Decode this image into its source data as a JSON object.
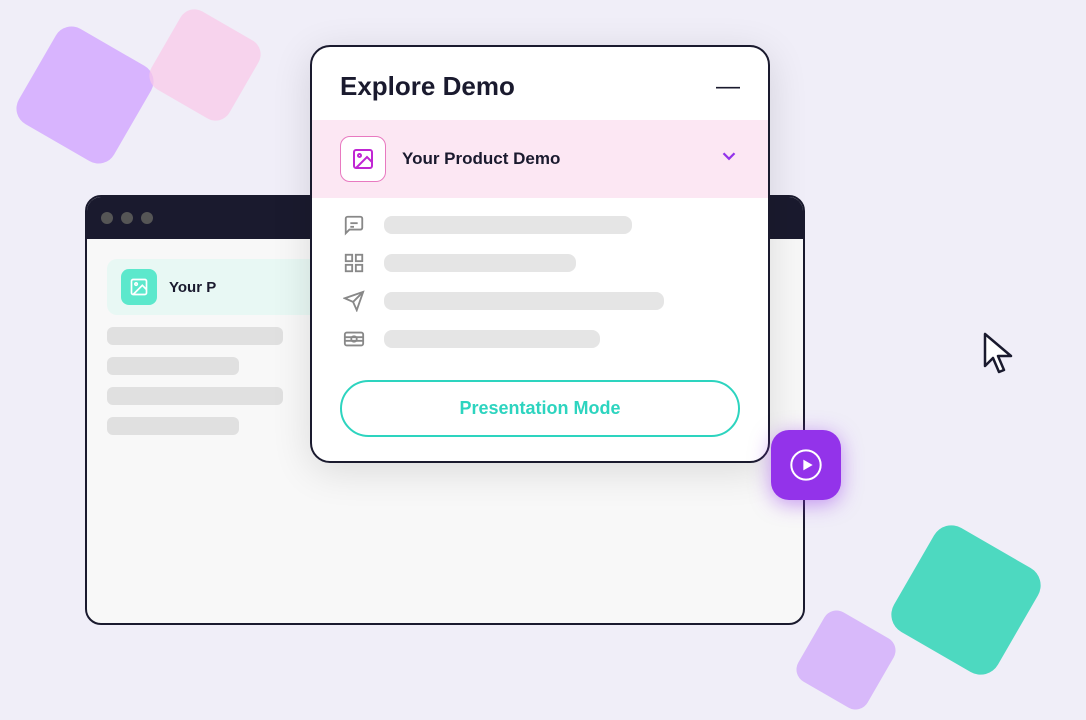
{
  "background": {
    "color": "#f0eef8"
  },
  "modal": {
    "title": "Explore Demo",
    "minimize_label": "—",
    "selected_item": {
      "label": "Your Product Demo",
      "icon_alt": "image-icon"
    },
    "menu_items": [
      {
        "icon": "chat-icon",
        "bar_width": "62%"
      },
      {
        "icon": "layout-icon",
        "bar_width": "48%"
      },
      {
        "icon": "send-icon",
        "bar_width": "70%"
      },
      {
        "icon": "dollar-icon",
        "bar_width": "54%"
      }
    ],
    "presentation_button": {
      "label": "Presentation Mode"
    }
  },
  "bg_browser": {
    "sidebar_item_label": "Your P"
  },
  "play_button": {
    "icon": "play-icon"
  },
  "cursor": {
    "icon": "cursor-icon"
  }
}
